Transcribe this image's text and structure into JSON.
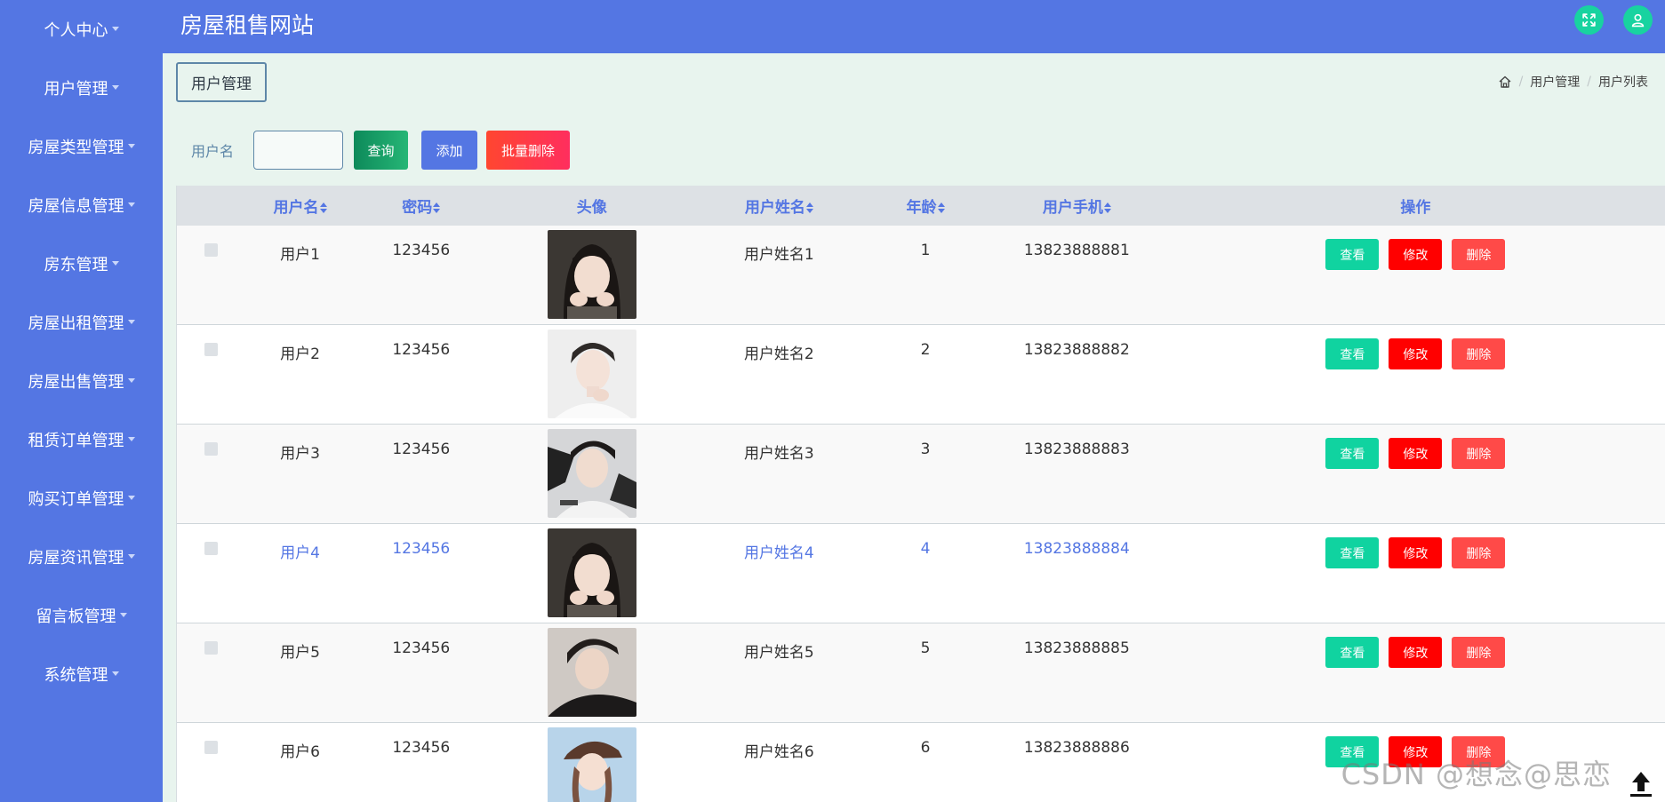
{
  "header": {
    "title": "房屋租售网站"
  },
  "sidebar": {
    "items": [
      {
        "label": "个人中心"
      },
      {
        "label": "用户管理"
      },
      {
        "label": "房屋类型管理"
      },
      {
        "label": "房屋信息管理"
      },
      {
        "label": "房东管理"
      },
      {
        "label": "房屋出租管理"
      },
      {
        "label": "房屋出售管理"
      },
      {
        "label": "租赁订单管理"
      },
      {
        "label": "购买订单管理"
      },
      {
        "label": "房屋资讯管理"
      },
      {
        "label": "留言板管理"
      },
      {
        "label": "系统管理"
      }
    ]
  },
  "page": {
    "section_title": "用户管理",
    "breadcrumb": [
      "用户管理",
      "用户列表"
    ]
  },
  "search": {
    "label": "用户名",
    "value": "",
    "query_label": "查询",
    "add_label": "添加",
    "batch_delete_label": "批量删除"
  },
  "table": {
    "headers": [
      "用户名",
      "密码",
      "头像",
      "用户姓名",
      "年龄",
      "用户手机",
      "操作"
    ],
    "actions": {
      "view": "查看",
      "edit": "修改",
      "delete": "删除"
    },
    "rows": [
      {
        "username": "用户1",
        "password": "123456",
        "name": "用户姓名1",
        "age": "1",
        "phone": "13823888881"
      },
      {
        "username": "用户2",
        "password": "123456",
        "name": "用户姓名2",
        "age": "2",
        "phone": "13823888882"
      },
      {
        "username": "用户3",
        "password": "123456",
        "name": "用户姓名3",
        "age": "3",
        "phone": "13823888883"
      },
      {
        "username": "用户4",
        "password": "123456",
        "name": "用户姓名4",
        "age": "4",
        "phone": "13823888884"
      },
      {
        "username": "用户5",
        "password": "123456",
        "name": "用户姓名5",
        "age": "5",
        "phone": "13823888885"
      },
      {
        "username": "用户6",
        "password": "123456",
        "name": "用户姓名6",
        "age": "6",
        "phone": "13823888886"
      }
    ]
  },
  "watermark": "CSDN @想念@思恋",
  "colors": {
    "primary": "#5476e3",
    "success": "#10d3a0",
    "danger": "#ff0000",
    "delete": "#ff4a48",
    "background": "#e8f4ee"
  }
}
